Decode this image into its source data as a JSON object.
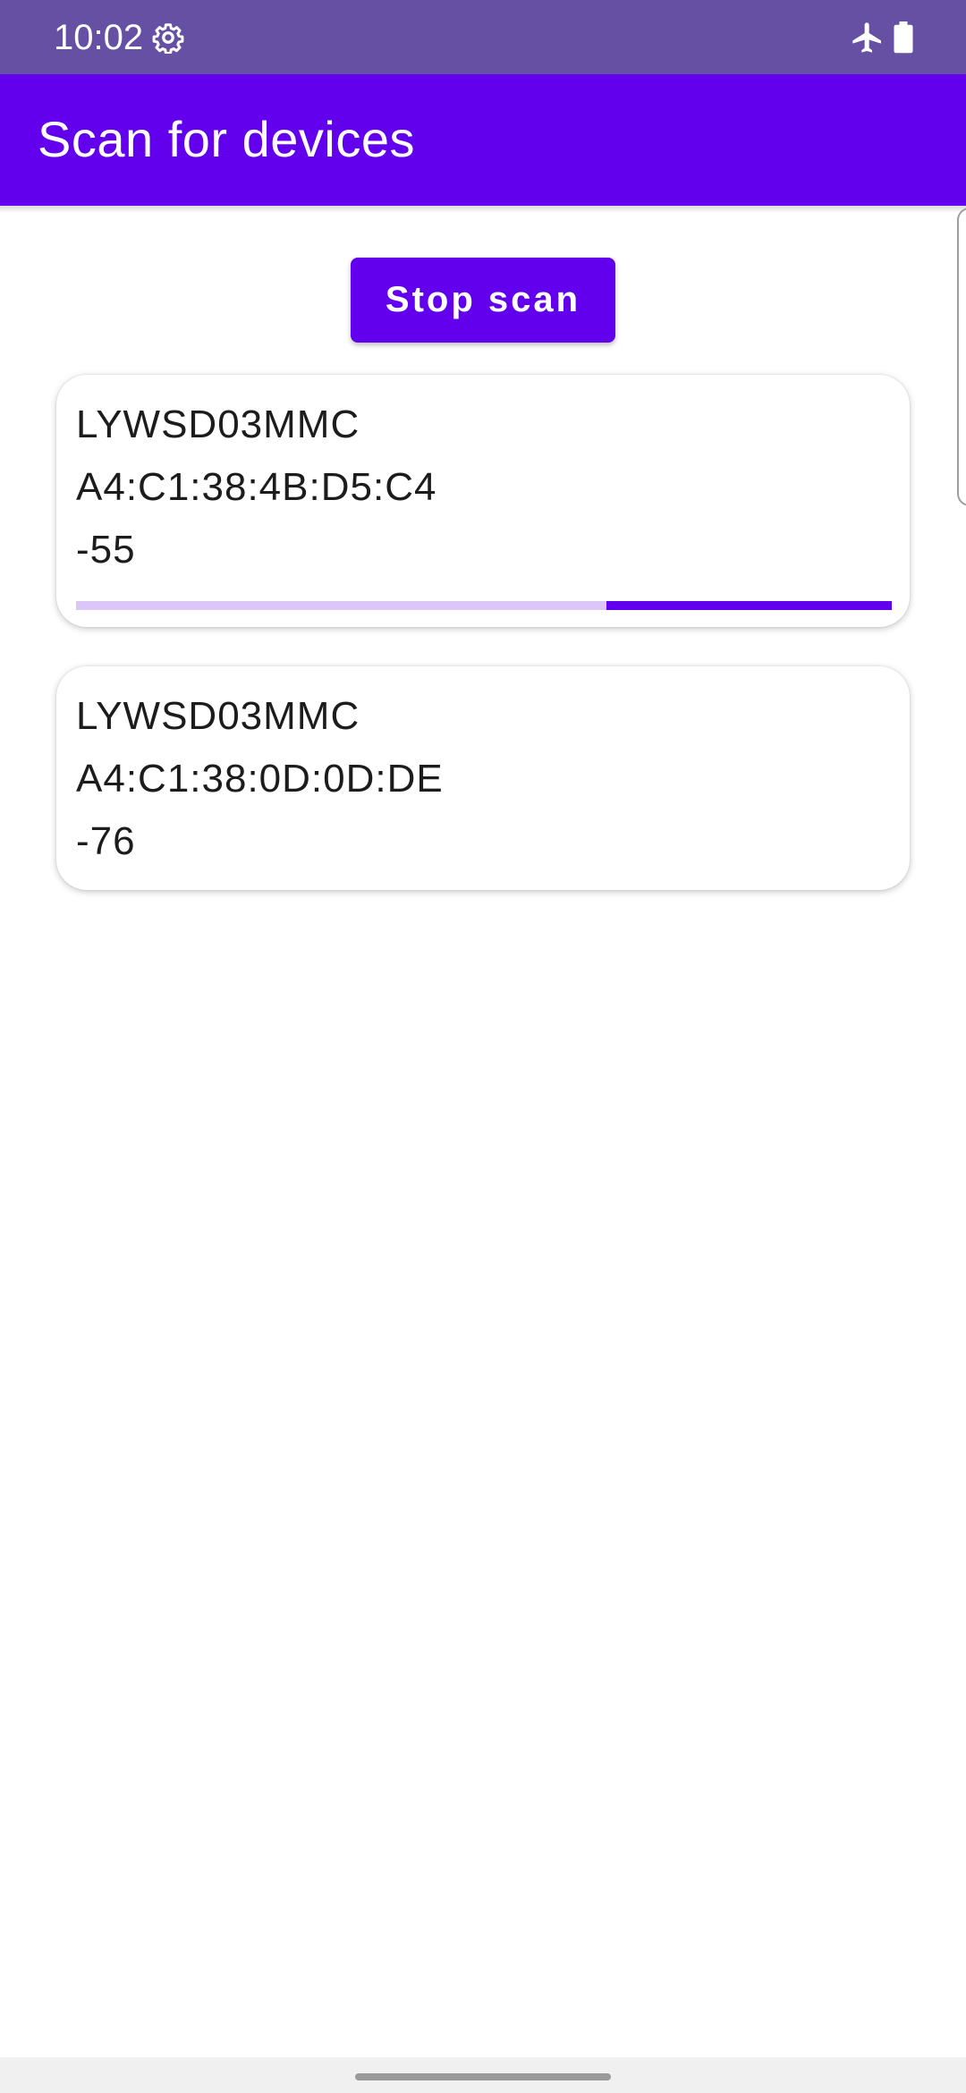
{
  "status_bar": {
    "time": "10:02",
    "settings_icon": "gear-icon",
    "airplane_icon": "airplane-icon",
    "battery_icon": "battery-icon",
    "background": "#6650a4"
  },
  "app_bar": {
    "title": "Scan for devices",
    "background": "#6200ee"
  },
  "scan_button": {
    "label": "Stop scan",
    "color": "#6200ee"
  },
  "devices": [
    {
      "name": "LYWSD03MMC",
      "mac": "A4:C1:38:4B:D5:C4",
      "rssi": "-55",
      "connecting_progress_fraction": 0.35
    },
    {
      "name": "LYWSD03MMC",
      "mac": "A4:C1:38:0D:0D:DE",
      "rssi": "-76"
    }
  ],
  "colors": {
    "accent": "#6200ee",
    "progress_track": "#dcc6f7"
  }
}
